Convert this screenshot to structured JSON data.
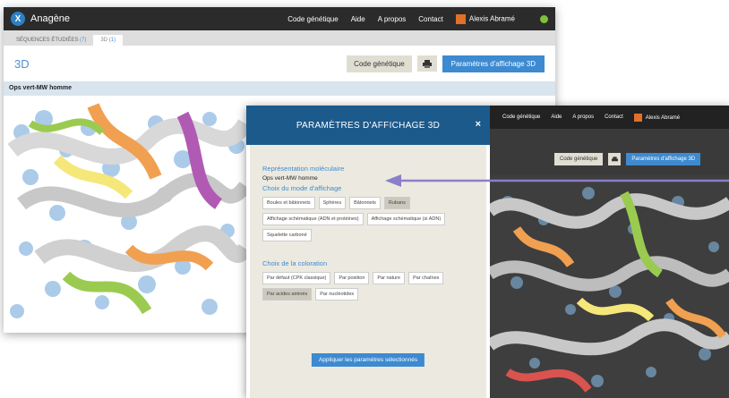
{
  "back_window": {
    "app_name": "Anagène",
    "logo_glyph": "X",
    "nav": [
      "Code génétique",
      "Aide",
      "A propos",
      "Contact"
    ],
    "user": "Alexis Abramé",
    "tabs": [
      {
        "label": "SÉQUENCES ÉTUDIÉES",
        "count": "(7)"
      },
      {
        "label": "3D",
        "count": "(1)"
      }
    ],
    "page_title": "3D",
    "btn_code": "Code génétique",
    "btn_print_icon": "printer-icon",
    "btn_params": "Paramètres d'affichage 3D",
    "sequence_label": "Ops vert-MW homme"
  },
  "front_window": {
    "nav": [
      "Code génétique",
      "Aide",
      "A propos",
      "Contact"
    ],
    "user": "Alexis Abramé",
    "btn_code": "Code génétique",
    "btn_params": "Paramètres d'affichage 3D"
  },
  "modal": {
    "title": "PARAMÈTRES D'AFFICHAGE 3D",
    "close": "×",
    "mol_rep_title": "Représentation moléculaire",
    "mol_rep_value": "Ops vert-MW homme",
    "mode_title": "Choix du mode d'affichage",
    "modes": [
      {
        "label": "Boules et bâtonnets",
        "selected": false
      },
      {
        "label": "Sphères",
        "selected": false
      },
      {
        "label": "Bâtonnets",
        "selected": false
      },
      {
        "label": "Rubans",
        "selected": true
      },
      {
        "label": "Affichage schématique (ADN et protéines)",
        "selected": false
      },
      {
        "label": "Affichage schématique (si ADN)",
        "selected": false
      },
      {
        "label": "Squelette carboné",
        "selected": false
      }
    ],
    "color_title": "Choix de la coloration",
    "colors": [
      {
        "label": "Par défaut (CPK classique)",
        "selected": false
      },
      {
        "label": "Par position",
        "selected": false
      },
      {
        "label": "Par nature",
        "selected": false
      },
      {
        "label": "Par chaînes",
        "selected": false
      },
      {
        "label": "Par acides aminés",
        "selected": true
      },
      {
        "label": "Par nucléotides",
        "selected": false
      }
    ],
    "apply": "Appliquer les paramètres sélectionnés"
  },
  "colors": {
    "nav_bg": "#2b2b2b",
    "accent_blue": "#3d8ad1",
    "modal_header": "#1c5a8c",
    "modal_body": "#eceae0",
    "arrow": "#8a7fc8"
  }
}
